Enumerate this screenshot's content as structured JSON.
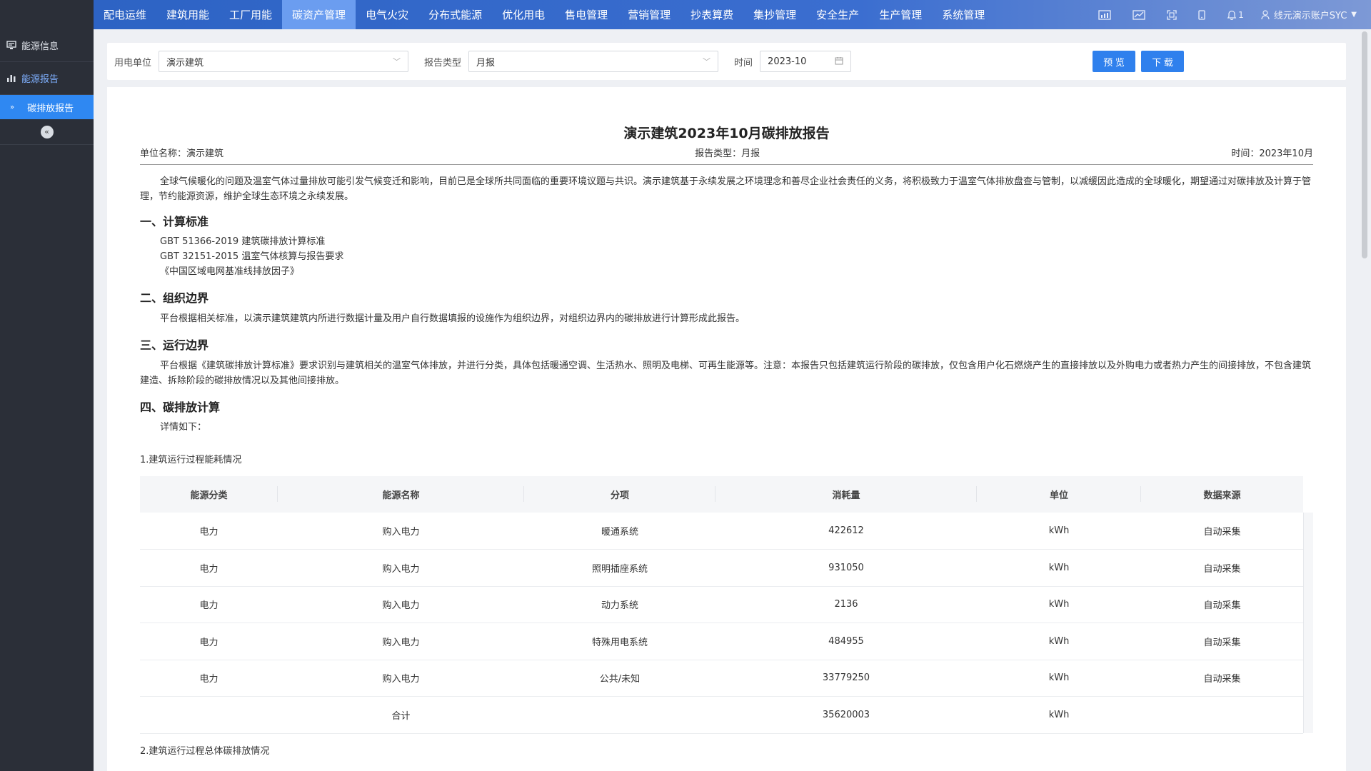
{
  "sidebar": {
    "items": [
      {
        "label": "能源信息",
        "icon": "monitor-icon"
      },
      {
        "label": "能源报告",
        "icon": "bar-chart-icon"
      }
    ],
    "sub_item": "碳排放报告",
    "collapse_icon": "double-chevron-left-icon"
  },
  "topnav": {
    "items": [
      "配电运维",
      "建筑用能",
      "工厂用能",
      "碳资产管理",
      "电气火灾",
      "分布式能源",
      "优化用电",
      "售电管理",
      "营销管理",
      "抄表算费",
      "集抄管理",
      "安全生产",
      "生产管理",
      "系统管理"
    ],
    "active_index": 3,
    "notification_count": "1",
    "user": "线元演示账户SYC"
  },
  "filter": {
    "unit_label": "用电单位",
    "unit_value": "演示建筑",
    "type_label": "报告类型",
    "type_value": "月报",
    "time_label": "时间",
    "time_value": "2023-10",
    "preview_label": "预 览",
    "download_label": "下 载"
  },
  "report": {
    "title": "演示建筑2023年10月碳排放报告",
    "meta_unit": "单位名称：演示建筑",
    "meta_type": "报告类型：月报",
    "meta_time": "时间：2023年10月",
    "intro": "全球气候暖化的问题及温室气体过量排放可能引发气候变迁和影响，目前已是全球所共同面临的重要环境议题与共识。演示建筑基于永续发展之环境理念和善尽企业社会责任的义务，将积极致力于温室气体排放盘查与管制，以减缓因此造成的全球暖化，期望通过对碳排放及计算于管理，节约能源资源，维护全球生态环境之永续发展。",
    "s1_title": "一、计算标准",
    "s1_items": [
      "GBT 51366-2019 建筑碳排放计算标准",
      "GBT 32151-2015 温室气体核算与报告要求",
      "《中国区域电网基准线排放因子》"
    ],
    "s2_title": "二、组织边界",
    "s2_text": "平台根据相关标准，以演示建筑建筑内所进行数据计量及用户自行数据填报的设施作为组织边界，对组织边界内的碳排放进行计算形成此报告。",
    "s3_title": "三、运行边界",
    "s3_text": "平台根据《建筑碳排放计算标准》要求识别与建筑相关的温室气体排放，并进行分类，具体包括暖通空调、生活热水、照明及电梯、可再生能源等。注意：本报告只包括建筑运行阶段的碳排放，仅包含用户化石燃烧产生的直接排放以及外购电力或者热力产生的间接排放，不包含建筑建造、拆除阶段的碳排放情况以及其他间接排放。",
    "s4_title": "四、碳排放计算",
    "s4_text": "详情如下：",
    "sub1": "1.建筑运行过程能耗情况",
    "sub2": "2.建筑运行过程总体碳排放情况",
    "table": {
      "headers": [
        "能源分类",
        "能源名称",
        "分项",
        "消耗量",
        "单位",
        "数据来源"
      ],
      "rows": [
        [
          "电力",
          "购入电力",
          "暖通系统",
          "422612",
          "kWh",
          "自动采集"
        ],
        [
          "电力",
          "购入电力",
          "照明插座系统",
          "931050",
          "kWh",
          "自动采集"
        ],
        [
          "电力",
          "购入电力",
          "动力系统",
          "2136",
          "kWh",
          "自动采集"
        ],
        [
          "电力",
          "购入电力",
          "特殊用电系统",
          "484955",
          "kWh",
          "自动采集"
        ],
        [
          "电力",
          "购入电力",
          "公共/未知",
          "33779250",
          "kWh",
          "自动采集"
        ]
      ],
      "total": [
        "",
        "合计",
        "",
        "35620003",
        "kWh",
        ""
      ]
    }
  }
}
